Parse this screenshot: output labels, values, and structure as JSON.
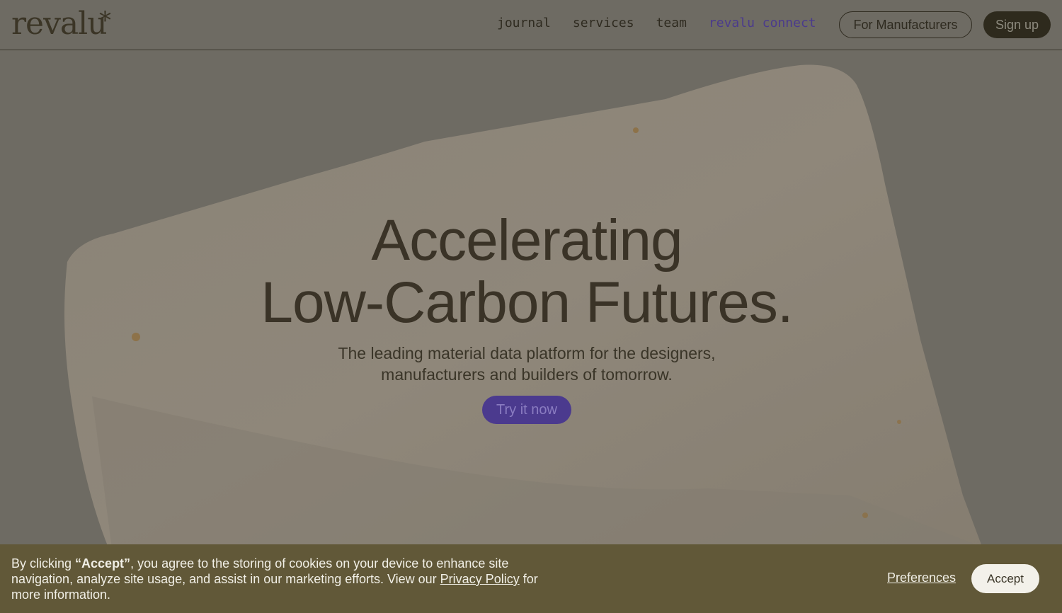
{
  "header": {
    "logo": "revalu",
    "logo_mark": "*",
    "nav": [
      {
        "label": "journal"
      },
      {
        "label": "services"
      },
      {
        "label": "team"
      },
      {
        "label": "revalu connect"
      }
    ],
    "for_manufacturers": "For Manufacturers",
    "sign_up": "Sign up"
  },
  "hero": {
    "headline_line1": "Accelerating",
    "headline_line2": "Low-Carbon Futures.",
    "sub_line1": "The leading material data platform for the designers,",
    "sub_line2": "manufacturers and builders of tomorrow.",
    "cta": "Try it now"
  },
  "cookie": {
    "text_before": "By clicking ",
    "text_bold": "“Accept”",
    "text_after": ", you agree to the storing of cookies on your device to enhance site navigation, analyze site usage, and assist in our marketing efforts. View our ",
    "privacy_link": "Privacy Policy",
    "text_end": " for more information.",
    "preferences": "Preferences",
    "accept": "Accept"
  },
  "colors": {
    "accent": "#4b3a8e",
    "dark": "#2e2a1d",
    "cookie_bg": "#615838"
  }
}
